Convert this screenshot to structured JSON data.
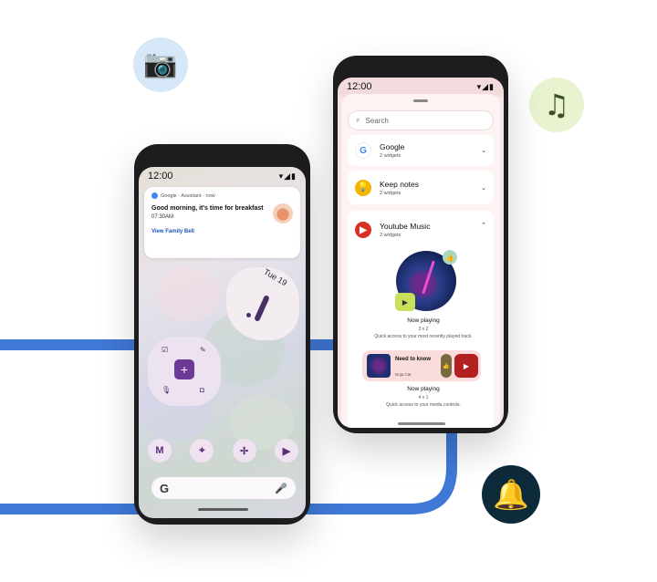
{
  "colors": {
    "track": "#3f78d6",
    "accent_purple": "#6c3a96",
    "yt_red": "#d93025"
  },
  "badges": {
    "camera_icon": "camera-icon",
    "music_icon": "music-note-icon",
    "bell_icon": "bell-icon"
  },
  "left_phone": {
    "status_time": "12:00",
    "notification": {
      "source": "Google · Assistant · now",
      "title": "Good morning, it's time for breakfast",
      "time": "07:30AM",
      "link": "View Family Bell"
    },
    "clock_date": "Tue 19",
    "search_logo": "G"
  },
  "right_phone": {
    "status_time": "12:00",
    "search_placeholder": "Search",
    "apps": [
      {
        "name": "Google",
        "sub": "2 widgets"
      },
      {
        "name": "Keep notes",
        "sub": "2 widgets"
      },
      {
        "name": "Youtube Music",
        "sub": "2 widgets"
      }
    ],
    "widget_large": {
      "title": "Now playing",
      "size": "3 x 2",
      "desc": "Quick access to your most recently played track."
    },
    "widget_small": {
      "track_title": "Need to know",
      "artist": "Doja Cat",
      "title": "Now playing",
      "size": "4 x 1",
      "desc": "Quick access to your media controls."
    }
  }
}
